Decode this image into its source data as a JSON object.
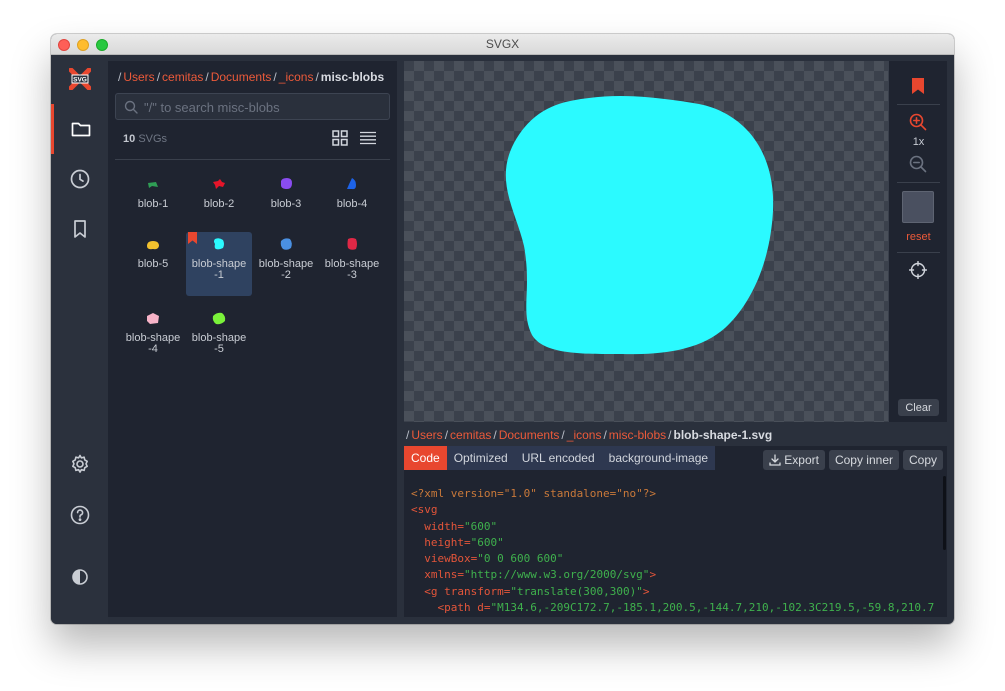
{
  "window": {
    "title": "SVGX"
  },
  "nav": {
    "logo_text": "SVG",
    "items": [
      {
        "name": "folder",
        "icon": "folder-icon",
        "active": true
      },
      {
        "name": "history",
        "icon": "clock-icon",
        "active": false
      },
      {
        "name": "bookmarks",
        "icon": "bookmark-icon",
        "active": false
      },
      {
        "name": "settings",
        "icon": "gear-icon",
        "active": false
      },
      {
        "name": "help",
        "icon": "help-icon",
        "active": false
      },
      {
        "name": "theme",
        "icon": "contrast-icon",
        "active": false
      }
    ]
  },
  "browser": {
    "breadcrumb": [
      "Users",
      "cemitas",
      "Documents",
      "_icons"
    ],
    "current_folder": "misc-blobs",
    "search_placeholder": "\"/\" to search misc-blobs",
    "count_number": "10",
    "count_label": "SVGs",
    "files": [
      {
        "name": "blob-1",
        "color": "#2f9e55",
        "bookmarked": false,
        "selected": false
      },
      {
        "name": "blob-2",
        "color": "#e5152a",
        "bookmarked": false,
        "selected": false
      },
      {
        "name": "blob-3",
        "color": "#8a4cf0",
        "bookmarked": false,
        "selected": false
      },
      {
        "name": "blob-4",
        "color": "#1d63e8",
        "bookmarked": false,
        "selected": false
      },
      {
        "name": "blob-5",
        "color": "#f2c12e",
        "bookmarked": false,
        "selected": false
      },
      {
        "name": "blob-shape-1",
        "color": "#2bfaff",
        "bookmarked": true,
        "selected": true
      },
      {
        "name": "blob-shape-2",
        "color": "#4a90e2",
        "bookmarked": false,
        "selected": false
      },
      {
        "name": "blob-shape-3",
        "color": "#e02846",
        "bookmarked": false,
        "selected": false
      },
      {
        "name": "blob-shape-4",
        "color": "#f7b3c8",
        "bookmarked": false,
        "selected": false
      },
      {
        "name": "blob-shape-5",
        "color": "#7af23a",
        "bookmarked": false,
        "selected": false
      }
    ]
  },
  "preview": {
    "shape_color": "#2bfaff",
    "zoom_label": "1x",
    "reset_label": "reset",
    "clear_label": "Clear"
  },
  "file_breadcrumb": {
    "parts": [
      "Users",
      "cemitas",
      "Documents",
      "_icons",
      "misc-blobs"
    ],
    "file": "blob-shape-1.svg"
  },
  "code_panel": {
    "tabs": [
      "Code",
      "Optimized",
      "URL encoded",
      "background-image"
    ],
    "active_tab": "Code",
    "buttons": {
      "export": "Export",
      "copy_inner": "Copy inner",
      "copy": "Copy"
    },
    "lines": {
      "l1": "<?xml version=\"1.0\" standalone=\"no\"?>",
      "l2_tag": "<svg",
      "l3_attr": "width=",
      "l3_val": "\"600\"",
      "l4_attr": "height=",
      "l4_val": "\"600\"",
      "l5_attr": "viewBox=",
      "l5_val": "\"0 0 600 600\"",
      "l6_attr": "xmlns=",
      "l6_val": "\"http://www.w3.org/2000/svg\"",
      "l6_end": ">",
      "l7_tag": "<g ",
      "l7_attr": "transform=",
      "l7_val": "\"translate(300,300)\"",
      "l7_end": ">",
      "l8_tag": "<path ",
      "l8_attr": "d=",
      "l8_val": "\"M134.6,-209C172.7,-185.1,200.5,-144.7,210,-102.3C219.5,-59.8,210.7,"
    }
  },
  "colors": {
    "accent": "#e8472f",
    "panel": "#1f2430",
    "sidebar": "#2b313d"
  }
}
